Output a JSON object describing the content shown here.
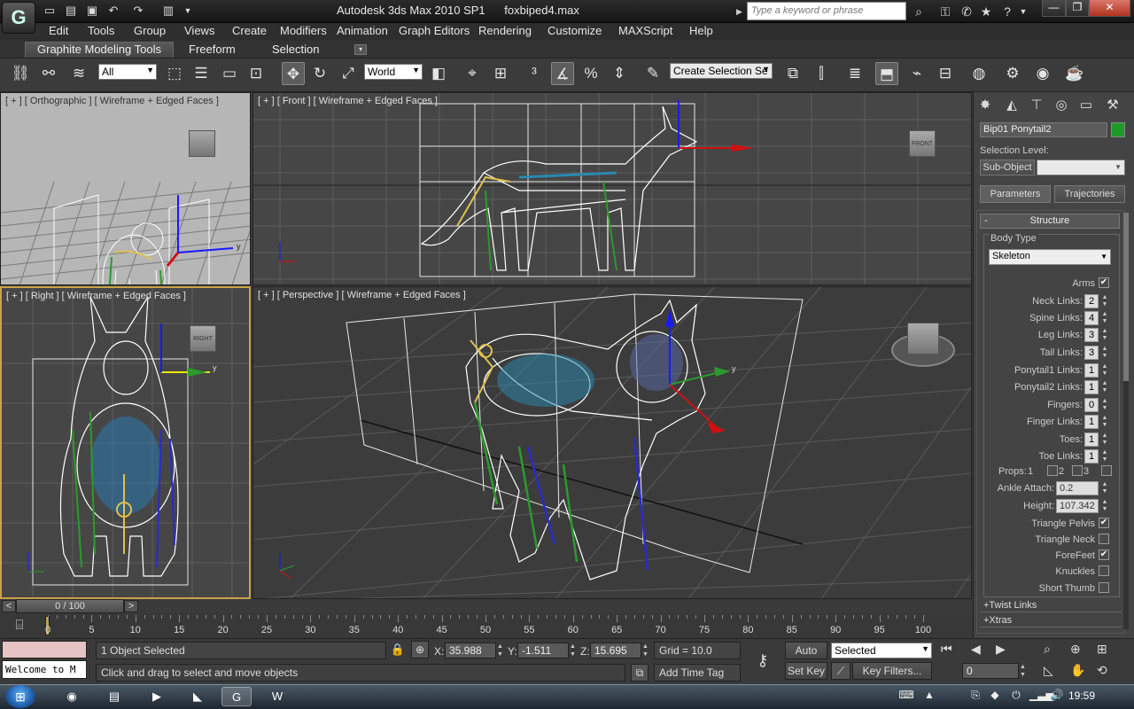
{
  "window": {
    "app_title": "Autodesk 3ds Max  2010 SP1",
    "file_name": "foxbiped4.max",
    "search_placeholder": "Type a keyword or phrase",
    "minimize": "—",
    "restore": "❐",
    "close": "✕"
  },
  "app_button": "G",
  "menu": [
    "Edit",
    "Tools",
    "Group",
    "Views",
    "Create",
    "Modifiers",
    "Animation",
    "Graph Editors",
    "Rendering",
    "Customize",
    "MAXScript",
    "Help"
  ],
  "ribbon": {
    "tabs": [
      "Graphite Modeling Tools",
      "Freeform",
      "Selection"
    ],
    "extra": "▾"
  },
  "toolbar": {
    "selection_filter": "All",
    "ref_coord": "World",
    "named_selection": "Create Selection Se"
  },
  "viewports": {
    "top_left": "[ + ] [ Orthographic ] [ Wireframe + Edged Faces ]",
    "front": "[ + ] [ Front ] [ Wireframe + Edged Faces ]",
    "right": "[ + ] [ Right ] [ Wireframe + Edged Faces ]",
    "perspective": "[ + ] [ Perspective ] [ Wireframe + Edged Faces ]",
    "cube_front": "FRONT",
    "cube_right": "RIGHT"
  },
  "command_panel": {
    "object_name": "Bip01 Ponytail2",
    "object_color": "#1f9a2a",
    "selection_level": "Selection Level:",
    "sub_object": "Sub-Object",
    "tab_parameters": "Parameters",
    "tab_trajectories": "Trajectories",
    "rollout": "Structure",
    "rollout_sign": "-",
    "body_type_label": "Body Type",
    "body_type_value": "Skeleton",
    "params": [
      {
        "label": "Arms",
        "kind": "check",
        "checked": true
      },
      {
        "label": "Neck Links:",
        "kind": "num",
        "value": "2"
      },
      {
        "label": "Spine Links:",
        "kind": "num",
        "value": "4"
      },
      {
        "label": "Leg Links:",
        "kind": "num",
        "value": "3"
      },
      {
        "label": "Tail Links:",
        "kind": "num",
        "value": "3"
      },
      {
        "label": "Ponytail1 Links:",
        "kind": "num",
        "value": "1"
      },
      {
        "label": "Ponytail2 Links:",
        "kind": "num",
        "value": "1"
      },
      {
        "label": "Fingers:",
        "kind": "num",
        "value": "0"
      },
      {
        "label": "Finger Links:",
        "kind": "num",
        "value": "1"
      },
      {
        "label": "Toes:",
        "kind": "num",
        "value": "1"
      },
      {
        "label": "Toe Links:",
        "kind": "num",
        "value": "1"
      }
    ],
    "props_label": "Props:",
    "props": [
      "1",
      "2",
      "3"
    ],
    "ankle_attach_label": "Ankle Attach:",
    "ankle_attach": "0.2",
    "height_label": "Height:",
    "height": "107.342",
    "checks": [
      {
        "label": "Triangle Pelvis",
        "checked": true
      },
      {
        "label": "Triangle Neck",
        "checked": false
      },
      {
        "label": "ForeFeet",
        "checked": true
      },
      {
        "label": "Knuckles",
        "checked": false
      },
      {
        "label": "Short Thumb",
        "checked": false
      }
    ],
    "twist_links": "+Twist Links",
    "xtras": "+Xtras"
  },
  "timeline": {
    "frame": "0 / 100",
    "prev": "<",
    "next": ">",
    "ticks": [
      "0",
      "5",
      "10",
      "15",
      "20",
      "25",
      "30",
      "35",
      "40",
      "45",
      "50",
      "55",
      "60",
      "65",
      "70",
      "75",
      "80",
      "85",
      "90",
      "95",
      "100"
    ]
  },
  "status": {
    "selected": "1 Object Selected",
    "prompt": "Click and drag to select and move objects",
    "listener": "Welcome to M",
    "x_label": "X:",
    "x": "35.988",
    "y_label": "Y:",
    "y": "-1.511",
    "z_label": "Z:",
    "z": "15.695",
    "grid": "Grid = 10.0",
    "add_time_tag": "Add Time Tag",
    "auto_key": "Auto Key",
    "set_key": "Set Key",
    "key_mode": "Selected",
    "key_filters": "Key Filters...",
    "current_frame": "0"
  },
  "taskbar": {
    "clock": "19:59"
  }
}
